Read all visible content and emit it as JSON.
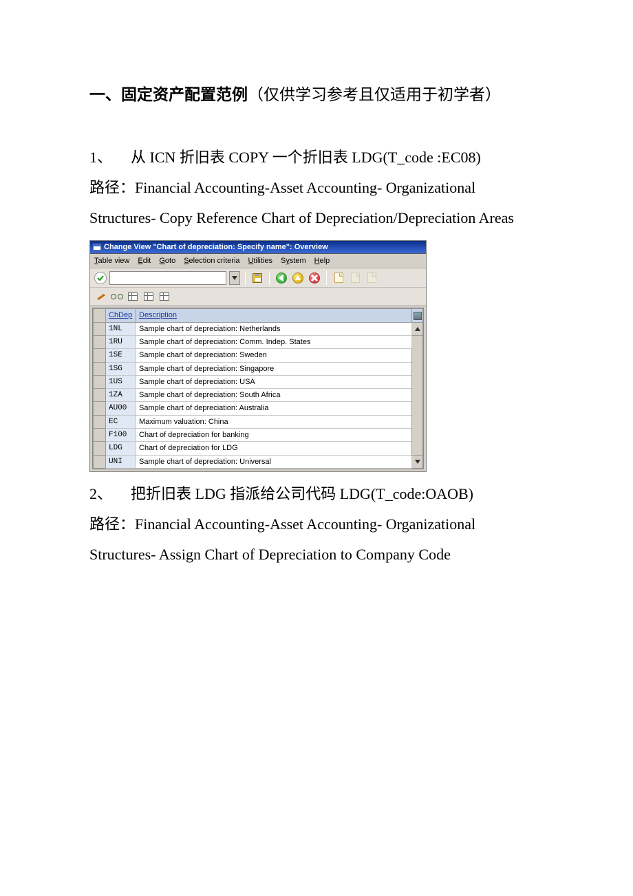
{
  "doc": {
    "heading_bold": "一、固定资产配置范例",
    "heading_light": "（仅供学习参考且仅适用于初学者）",
    "step1_num": "1、",
    "step1_title": "从 ICN 折旧表 COPY 一个折旧表 LDG(T_code :EC08)",
    "step1_path_label": "路径：",
    "step1_path": "Financial Accounting-Asset Accounting- Organizational Structures- Copy Reference Chart of Depreciation/Depreciation Areas",
    "step2_num": "2、",
    "step2_title": "把折旧表 LDG 指派给公司代码 LDG(T_code:OAOB)",
    "step2_path_label": "路径：",
    "step2_path": "Financial Accounting-Asset Accounting- Organizational Structures- Assign Chart of Depreciation to Company Code"
  },
  "sap": {
    "title": "Change View \"Chart of depreciation: Specify name\": Overview",
    "menu": {
      "table_view": "Table view",
      "edit": "Edit",
      "goto": "Goto",
      "selection": "Selection criteria",
      "utilities": "Utilities",
      "system": "System",
      "help": "Help"
    },
    "cols": {
      "code": "ChDep",
      "desc": "Description"
    },
    "rows": [
      {
        "code": "1NL",
        "desc": "Sample chart of depreciation: Netherlands"
      },
      {
        "code": "1RU",
        "desc": "Sample chart of depreciation: Comm. Indep. States"
      },
      {
        "code": "1SE",
        "desc": "Sample chart of depreciation: Sweden"
      },
      {
        "code": "1SG",
        "desc": "Sample chart of depreciation: Singapore"
      },
      {
        "code": "1US",
        "desc": "Sample chart of depreciation: USA"
      },
      {
        "code": "1ZA",
        "desc": "Sample chart of depreciation: South Africa"
      },
      {
        "code": "AU00",
        "desc": "Sample chart of depreciation: Australia"
      },
      {
        "code": "EC",
        "desc": "Maximum valuation: China"
      },
      {
        "code": "F100",
        "desc": "Chart of depreciation for banking"
      },
      {
        "code": "LDG",
        "desc": "Chart of depreciation for LDG"
      },
      {
        "code": "UNI",
        "desc": "Sample chart of depreciation: Universal"
      }
    ]
  }
}
